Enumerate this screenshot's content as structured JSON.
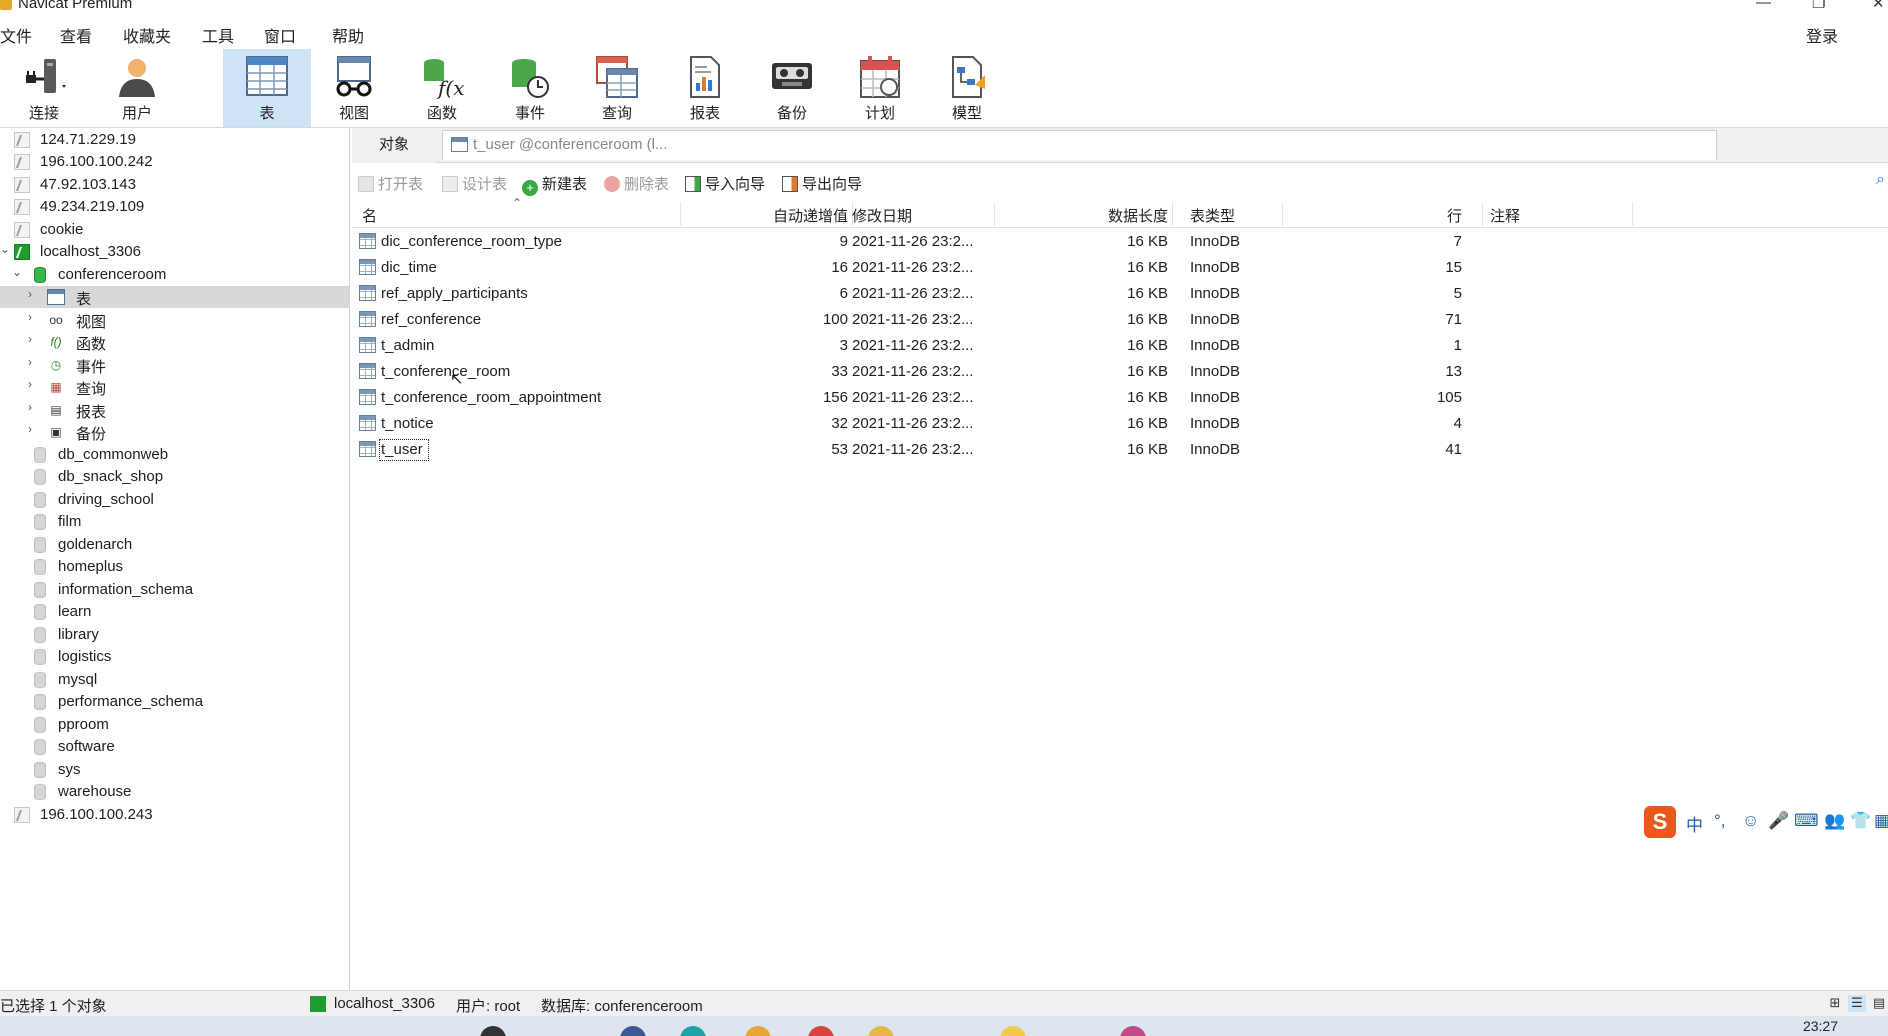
{
  "window": {
    "title": "Navicat Premium"
  },
  "menu": [
    "文件",
    "查看",
    "收藏夹",
    "工具",
    "窗口",
    "帮助"
  ],
  "login_label": "登录",
  "toolbar": [
    {
      "id": "connect",
      "label": "连接",
      "icon": "plug-icon"
    },
    {
      "id": "user",
      "label": "用户",
      "icon": "user-icon"
    },
    {
      "id": "table",
      "label": "表",
      "icon": "table-icon",
      "active": true
    },
    {
      "id": "view",
      "label": "视图",
      "icon": "glasses-icon"
    },
    {
      "id": "function",
      "label": "函数",
      "icon": "function-icon"
    },
    {
      "id": "event",
      "label": "事件",
      "icon": "event-clock-icon"
    },
    {
      "id": "query",
      "label": "查询",
      "icon": "query-icon"
    },
    {
      "id": "report",
      "label": "报表",
      "icon": "report-icon"
    },
    {
      "id": "backup",
      "label": "备份",
      "icon": "backup-icon"
    },
    {
      "id": "schedule",
      "label": "计划",
      "icon": "calendar-icon"
    },
    {
      "id": "model",
      "label": "模型",
      "icon": "model-icon"
    }
  ],
  "tree": {
    "connections_top": [
      "124.71.229.19",
      "196.100.100.242",
      "47.92.103.143",
      "49.234.219.109",
      "cookie"
    ],
    "active_connection": "localhost_3306",
    "active_db": "conferenceroom",
    "db_children": [
      "表",
      "视图",
      "函数",
      "事件",
      "查询",
      "报表",
      "备份"
    ],
    "databases": [
      "db_commonweb",
      "db_snack_shop",
      "driving_school",
      "film",
      "goldenarch",
      "homeplus",
      "information_schema",
      "learn",
      "library",
      "logistics",
      "mysql",
      "performance_schema",
      "pproom",
      "software",
      "sys",
      "warehouse"
    ],
    "connections_bottom": [
      "196.100.100.243"
    ]
  },
  "tabs": {
    "objects": "对象",
    "open_tab": "t_user @conferenceroom (l..."
  },
  "actions": [
    {
      "label": "打开表",
      "enabled": false
    },
    {
      "label": "设计表",
      "enabled": false
    },
    {
      "label": "新建表",
      "enabled": true
    },
    {
      "label": "删除表",
      "enabled": false
    },
    {
      "label": "导入向导",
      "enabled": true
    },
    {
      "label": "导出向导",
      "enabled": true
    }
  ],
  "table": {
    "columns": [
      "名",
      "自动递增值",
      "修改日期",
      "数据长度",
      "表类型",
      "行",
      "注释"
    ],
    "rows": [
      {
        "name": "dic_conference_room_type",
        "auto_inc": "9",
        "modified": "2021-11-26 23:2...",
        "size": "16 KB",
        "engine": "InnoDB",
        "rows": "7",
        "comment": ""
      },
      {
        "name": "dic_time",
        "auto_inc": "16",
        "modified": "2021-11-26 23:2...",
        "size": "16 KB",
        "engine": "InnoDB",
        "rows": "15",
        "comment": ""
      },
      {
        "name": "ref_apply_participants",
        "auto_inc": "6",
        "modified": "2021-11-26 23:2...",
        "size": "16 KB",
        "engine": "InnoDB",
        "rows": "5",
        "comment": ""
      },
      {
        "name": "ref_conference",
        "auto_inc": "100",
        "modified": "2021-11-26 23:2...",
        "size": "16 KB",
        "engine": "InnoDB",
        "rows": "71",
        "comment": ""
      },
      {
        "name": "t_admin",
        "auto_inc": "3",
        "modified": "2021-11-26 23:2...",
        "size": "16 KB",
        "engine": "InnoDB",
        "rows": "1",
        "comment": ""
      },
      {
        "name": "t_conference_room",
        "auto_inc": "33",
        "modified": "2021-11-26 23:2...",
        "size": "16 KB",
        "engine": "InnoDB",
        "rows": "13",
        "comment": ""
      },
      {
        "name": "t_conference_room_appointment",
        "auto_inc": "156",
        "modified": "2021-11-26 23:2...",
        "size": "16 KB",
        "engine": "InnoDB",
        "rows": "105",
        "comment": ""
      },
      {
        "name": "t_notice",
        "auto_inc": "32",
        "modified": "2021-11-26 23:2...",
        "size": "16 KB",
        "engine": "InnoDB",
        "rows": "4",
        "comment": ""
      },
      {
        "name": "t_user",
        "auto_inc": "53",
        "modified": "2021-11-26 23:2...",
        "size": "16 KB",
        "engine": "InnoDB",
        "rows": "41",
        "comment": ""
      }
    ],
    "selected_row": "t_user"
  },
  "ime": {
    "logo": "S",
    "mode": "中"
  },
  "status": {
    "selection": "已选择 1 个对象",
    "connection": "localhost_3306",
    "user": "用户: root",
    "database": "数据库: conferenceroom"
  },
  "taskbar": {
    "time": "23:27"
  },
  "colors": {
    "selected_tab": "#cfe3f7",
    "connected": "#1d9c2f",
    "ime_brand": "#e85a1c"
  }
}
